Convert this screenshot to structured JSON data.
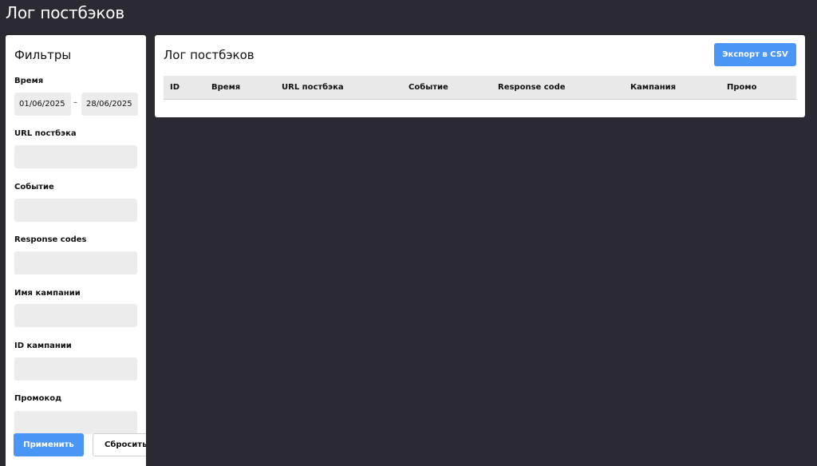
{
  "page": {
    "title": "Лог постбэков"
  },
  "filters": {
    "title": "Фильтры",
    "time": {
      "label": "Время",
      "from": "01/06/2025",
      "separator": "–",
      "to": "28/06/2025"
    },
    "fields": [
      {
        "label": "URL постбэка",
        "value": ""
      },
      {
        "label": "Событие",
        "value": ""
      },
      {
        "label": "Response codes",
        "value": ""
      },
      {
        "label": "Имя кампании",
        "value": ""
      },
      {
        "label": "ID кампании",
        "value": ""
      },
      {
        "label": "Промокод",
        "value": ""
      }
    ],
    "apply_label": "Применить",
    "reset_label": "Сбросить"
  },
  "log": {
    "title": "Лог постбэков",
    "export_label": "Экспорт в CSV",
    "columns": [
      "ID",
      "Время",
      "URL постбэка",
      "Событие",
      "Response code",
      "Кампания",
      "Промо"
    ],
    "rows": []
  },
  "colors": {
    "background": "#2b2a33",
    "accent": "#4a96f5",
    "input_bg": "#ececec",
    "table_header_bg": "#e9e9e9"
  }
}
